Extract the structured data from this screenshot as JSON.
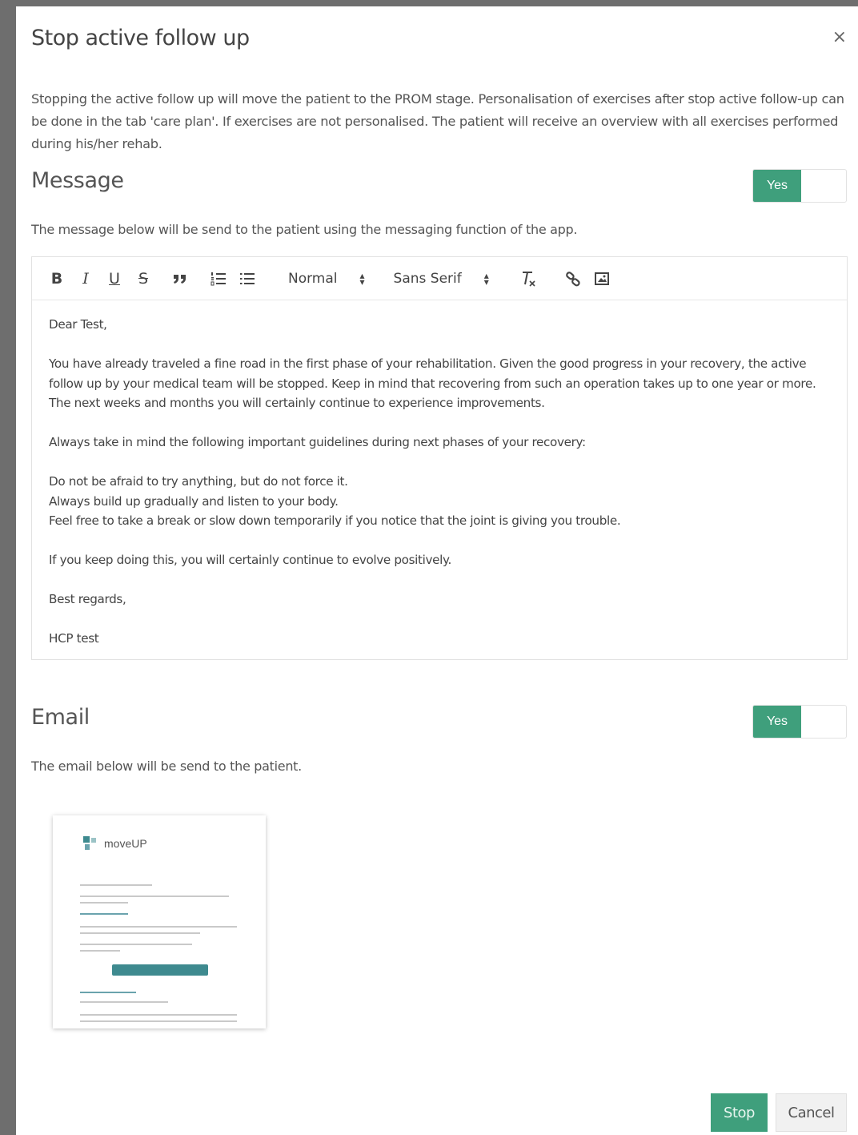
{
  "modal": {
    "title": "Stop active follow up",
    "close_glyph": "×",
    "intro": "Stopping the active follow up will move the patient to the PROM stage. Personalisation of exercises after stop active follow-up can be done in the tab 'care plan'. If exercises are not personalised. The patient will receive an overview with all exercises performed during his/her rehab."
  },
  "message": {
    "title": "Message",
    "toggle_label": "Yes",
    "description": "The message below will be send to the patient using the messaging function of the app.",
    "toolbar": {
      "bold": "B",
      "italic": "I",
      "underline": "U",
      "strike": "S",
      "quote": "❞",
      "ordered_list": "☰",
      "bullet_list": "☰",
      "size_select": "Normal",
      "font_select": "Sans Serif",
      "clean": "Tx",
      "link": "🔗",
      "image": "▣"
    },
    "body": {
      "greeting": "Dear Test,",
      "para1": "You have already traveled a fine road in the first phase of your rehabilitation. Given the good progress in your recovery, the active follow up by your medical team will be stopped. Keep in mind that recovering from such an operation takes up to one year or more. The next weeks and months you will certainly continue to experience improvements.",
      "para2": "Always take in mind the following important guidelines during next phases of your recovery:",
      "line1": "Do not be afraid to try anything, but do not force it.",
      "line2": "Always build up gradually and listen to your body.",
      "line3": "Feel free to take a break or slow down temporarily if you notice that the joint is giving you trouble.",
      "para3": "If you keep doing this, you will certainly continue to evolve positively.",
      "closing": "Best regards,",
      "signature": "HCP test"
    }
  },
  "email": {
    "title": "Email",
    "toggle_label": "Yes",
    "description": "The email below will be send to the patient.",
    "preview_brand": "moveUP"
  },
  "footer": {
    "stop_label": "Stop",
    "cancel_label": "Cancel"
  },
  "colors": {
    "accent": "#3f9f7c",
    "preview_button": "#3e8a8f"
  }
}
